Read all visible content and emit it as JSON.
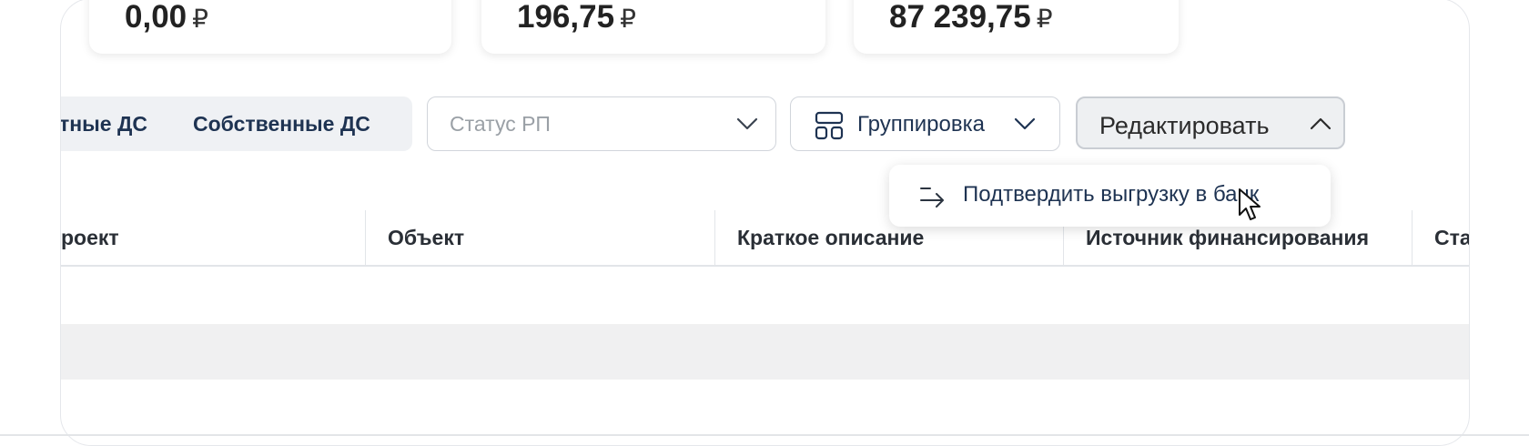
{
  "summary_cards": [
    {
      "amount": "0,00",
      "currency": "₽"
    },
    {
      "amount": "196,75",
      "currency": "₽"
    },
    {
      "amount": "87 239,75",
      "currency": "₽"
    }
  ],
  "toolbar": {
    "segments": [
      "тные ДС",
      "Собственные ДС"
    ],
    "status_placeholder": "Статус РП",
    "group_label": "Группировка",
    "edit_label": "Редактировать"
  },
  "edit_menu": {
    "items": [
      {
        "label": "Подтвердить выгрузку в банк",
        "icon": "arrow-right-icon"
      }
    ]
  },
  "table": {
    "headers": [
      "роект",
      "Объект",
      "Краткое описание",
      "Источник финансирования",
      "Ста"
    ]
  },
  "colors": {
    "accent_text": "#1e3352",
    "segment_bg": "#eff1f4"
  }
}
